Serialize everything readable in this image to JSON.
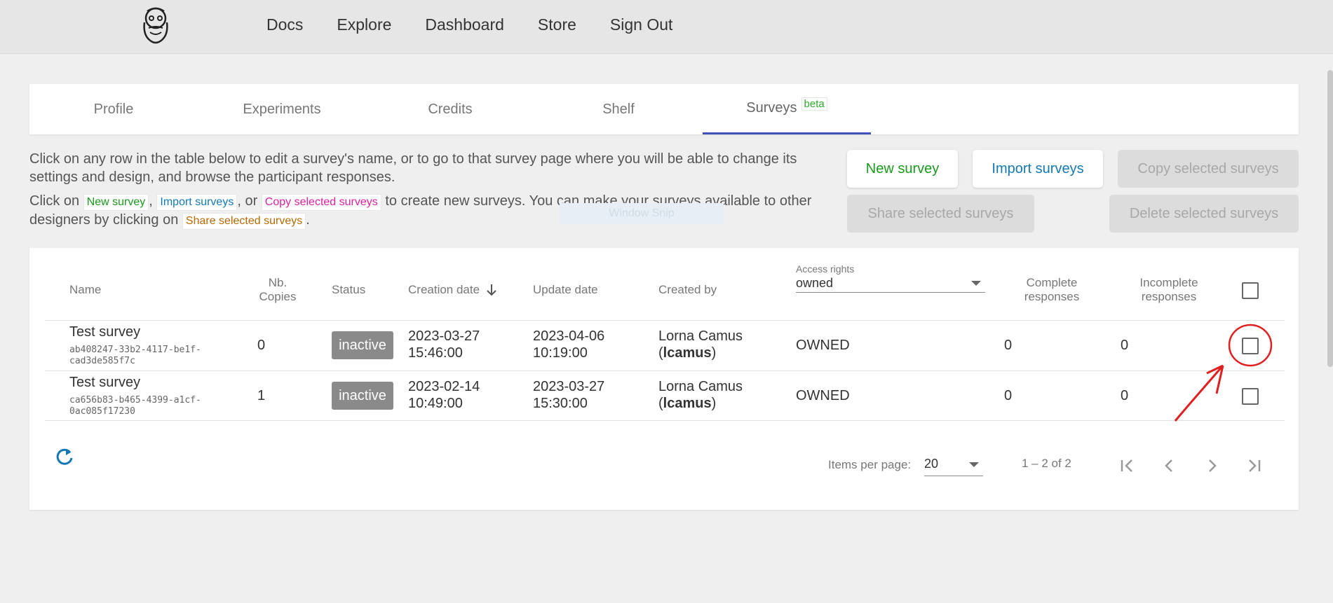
{
  "nav": {
    "logo_alt": "bearded-face-logo",
    "items": [
      "Docs",
      "Explore",
      "Dashboard",
      "Store",
      "Sign Out"
    ]
  },
  "tabs": {
    "items": [
      "Profile",
      "Experiments",
      "Credits",
      "Shelf",
      "Surveys"
    ],
    "active": "Surveys",
    "beta_badge": "beta"
  },
  "intro": {
    "line1": "Click on any row in the table below to edit a survey's name, or to go to that survey page where you will be able to change its settings and design, and browse the participant responses.",
    "line2_pre": "Click on",
    "sep1": ",",
    "sep2": ", or",
    "line2_mid": "to create new surveys. You can make your surveys available to other designers by clicking on",
    "line2_end": ".",
    "chip_new": "New survey",
    "chip_import": "Import surveys",
    "chip_copy": "Copy selected surveys",
    "chip_share": "Share selected surveys",
    "ghost_tooltip": "Window Snip"
  },
  "actions": {
    "new_survey": "New survey",
    "import_surveys": "Import surveys",
    "copy_selected": "Copy selected surveys",
    "share_selected": "Share selected surveys",
    "delete_selected": "Delete selected surveys"
  },
  "table": {
    "headers": {
      "name": "Name",
      "nb_copies_1": "Nb.",
      "nb_copies_2": "Copies",
      "status": "Status",
      "creation_date": "Creation date",
      "update_date": "Update date",
      "created_by": "Created by",
      "access_label": "Access rights",
      "access_value": "owned",
      "complete_1": "Complete",
      "complete_2": "responses",
      "incomplete_1": "Incomplete",
      "incomplete_2": "responses"
    },
    "rows": [
      {
        "name": "Test survey",
        "uuid_1": "ab408247-33b2-4117-be1f-",
        "uuid_2": "cad3de585f7c",
        "copies": "0",
        "status": "inactive",
        "created_1": "2023-03-27",
        "created_2": "15:46:00",
        "updated_1": "2023-04-06",
        "updated_2": "10:19:00",
        "creator_name": "Lorna Camus",
        "creator_user": "lcamus",
        "access": "OWNED",
        "complete": "0",
        "incomplete": "0"
      },
      {
        "name": "Test survey",
        "uuid_1": "ca656b83-b465-4399-a1cf-",
        "uuid_2": "0ac085f17230",
        "copies": "1",
        "status": "inactive",
        "created_1": "2023-02-14",
        "created_2": "10:49:00",
        "updated_1": "2023-03-27",
        "updated_2": "15:30:00",
        "creator_name": "Lorna Camus",
        "creator_user": "lcamus",
        "access": "OWNED",
        "complete": "0",
        "incomplete": "0"
      }
    ]
  },
  "pager": {
    "items_per_page_label": "Items per page:",
    "items_per_page_value": "20",
    "range": "1 – 2 of 2"
  },
  "colors": {
    "accent_tab": "#3f51b5",
    "green": "#1a9a1a",
    "blue": "#1379b5",
    "annotation_red": "#e02020"
  }
}
